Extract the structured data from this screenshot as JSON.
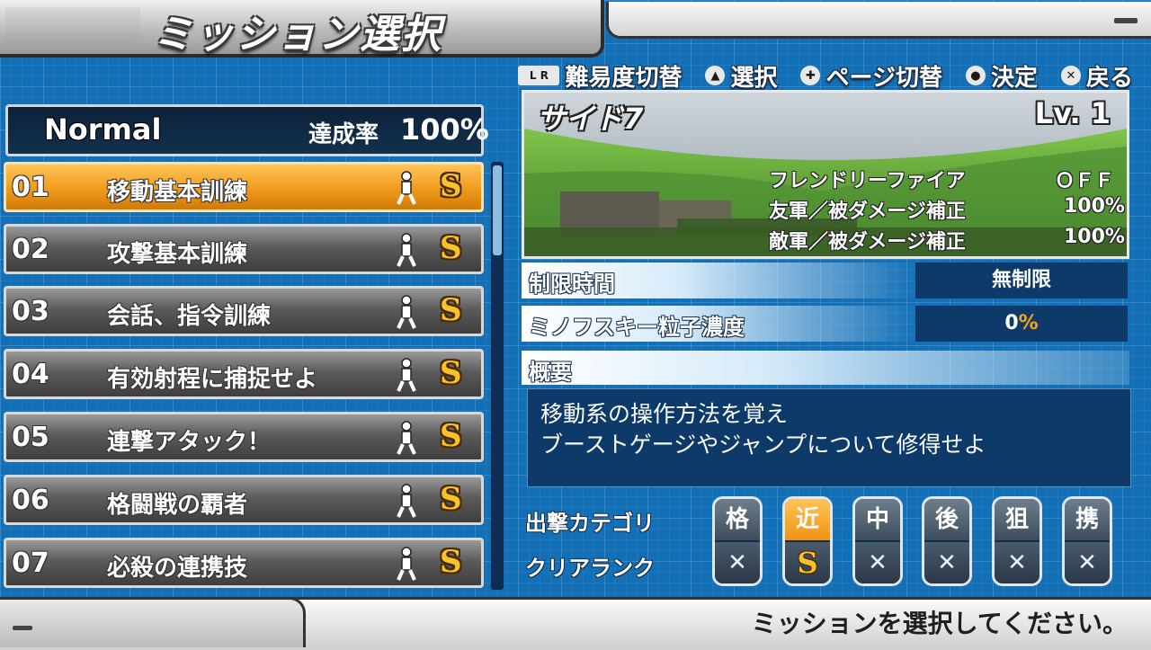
{
  "header": {
    "title": "ミッション選択"
  },
  "hints": [
    {
      "icon": "L R",
      "label": "難易度切替"
    },
    {
      "icon": "▲",
      "label": "選択"
    },
    {
      "icon": "✚",
      "label": "ページ切替"
    },
    {
      "icon": "●",
      "label": "決定"
    },
    {
      "icon": "✕",
      "label": "戻る"
    }
  ],
  "difficulty": {
    "name": "Normal",
    "rate_label": "達成率",
    "rate": "100%"
  },
  "missions": [
    {
      "num": "01",
      "name": "移動基本訓練",
      "rank": "S",
      "selected": true
    },
    {
      "num": "02",
      "name": "攻撃基本訓練",
      "rank": "S",
      "selected": false
    },
    {
      "num": "03",
      "name": "会話、指令訓練",
      "rank": "S",
      "selected": false
    },
    {
      "num": "04",
      "name": "有効射程に捕捉せよ",
      "rank": "S",
      "selected": false
    },
    {
      "num": "05",
      "name": "連撃アタック！",
      "rank": "S",
      "selected": false
    },
    {
      "num": "06",
      "name": "格闘戦の覇者",
      "rank": "S",
      "selected": false
    },
    {
      "num": "07",
      "name": "必殺の連携技",
      "rank": "S",
      "selected": false
    }
  ],
  "map": {
    "name": "サイド7",
    "level": "Lv. 1",
    "friendly_fire_label": "フレンドリーファイア",
    "friendly_fire_value": "ＯＦＦ",
    "ally_damage_label": "友軍／被ダメージ補正",
    "ally_damage_value": "100%",
    "enemy_damage_label": "敵軍／被ダメージ補正",
    "enemy_damage_value": "100%"
  },
  "info": {
    "time_label": "制限時間",
    "time_value": "無制限",
    "minovsky_label": "ミノフスキー粒子濃度",
    "minovsky_value": "0",
    "minovsky_unit": "%"
  },
  "summary": {
    "label": "概要",
    "line1": "移動系の操作方法を覚え",
    "line2": "ブーストゲージやジャンプについて修得せよ"
  },
  "categories": {
    "sortie_label": "出撃カテゴリ",
    "clear_label": "クリアランク",
    "items": [
      {
        "cat": "格",
        "rank": "✕",
        "active": false
      },
      {
        "cat": "近",
        "rank": "S",
        "active": true
      },
      {
        "cat": "中",
        "rank": "✕",
        "active": false
      },
      {
        "cat": "後",
        "rank": "✕",
        "active": false
      },
      {
        "cat": "狙",
        "rank": "✕",
        "active": false
      },
      {
        "cat": "携",
        "rank": "✕",
        "active": false
      }
    ]
  },
  "footer": {
    "message": "ミッションを選択してください。"
  },
  "colors": {
    "accent_orange": "#f19b1c",
    "rank_gold": "#f7c12b",
    "panel_blue": "#0d3a68"
  }
}
